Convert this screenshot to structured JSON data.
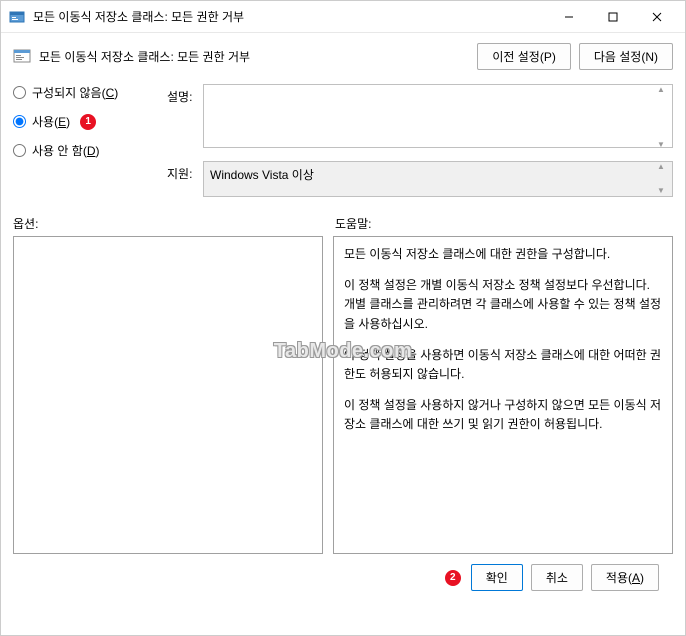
{
  "window": {
    "title": "모든 이동식 저장소 클래스: 모든 권한 거부"
  },
  "header": {
    "title": "모든 이동식 저장소 클래스: 모든 권한 거부",
    "prev_button": "이전 설정(P)",
    "next_button": "다음 설정(N)"
  },
  "radios": {
    "not_configured": "구성되지 않음(C)",
    "enabled": "사용(E)",
    "disabled": "사용 안 함(D)",
    "selected": "enabled",
    "badge1": "1"
  },
  "fields": {
    "desc_label": "설명:",
    "desc_value": "",
    "support_label": "지원:",
    "support_value": "Windows Vista 이상"
  },
  "panels": {
    "options_label": "옵션:",
    "help_label": "도움말:",
    "help_paragraphs": [
      "모든 이동식 저장소 클래스에 대한 권한을 구성합니다.",
      "이 정책 설정은 개별 이동식 저장소 정책 설정보다 우선합니다. 개별 클래스를 관리하려면 각 클래스에 사용할 수 있는 정책 설정을 사용하십시오.",
      "이 정책 설정을 사용하면 이동식 저장소 클래스에 대한 어떠한 권한도 허용되지 않습니다.",
      "이 정책 설정을 사용하지 않거나 구성하지 않으면 모든 이동식 저장소 클래스에 대한 쓰기 및 읽기 권한이 허용됩니다."
    ]
  },
  "footer": {
    "badge2": "2",
    "ok": "확인",
    "cancel": "취소",
    "apply": "적용(A)"
  },
  "watermark": "TabMode.com"
}
